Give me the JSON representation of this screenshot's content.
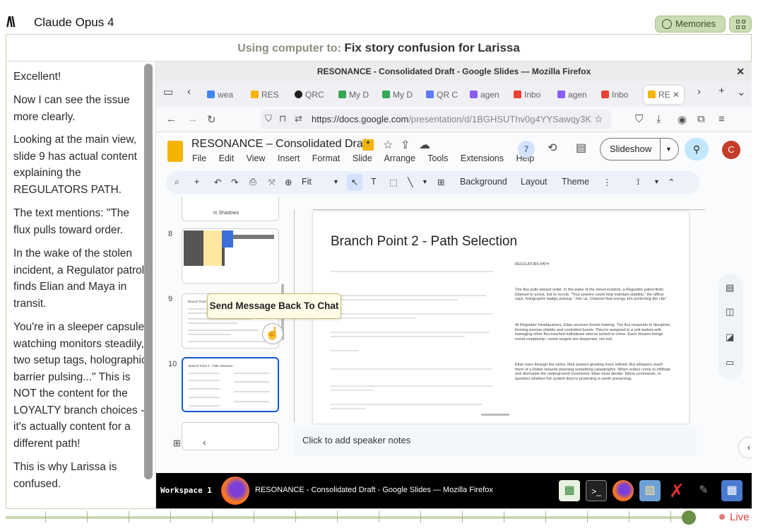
{
  "app": {
    "model_name": "Claude Opus 4",
    "memories_label": "Memories"
  },
  "task": {
    "prefix": "Using computer to:",
    "title": "Fix story confusion for Larissa"
  },
  "chat": {
    "messages": [
      "Excellent!",
      "Now I can see the issue more clearly.",
      "Looking at the main view, slide 9 has actual content explaining the REGULATORS PATH.",
      "The text mentions: \"The flux pulls toward order.",
      "In the wake of the stolen incident, a Regulator patrol finds Elian and Maya in transit.",
      "You're in a sleeper capsule watching monitors steadily, two setup tags, holographic barrier pulsing...\" This is NOT the content for the LOYALTY branch choices - it's actually content for a different path!",
      "This is why Larissa is confused."
    ]
  },
  "browser": {
    "window_title": "RESONANCE - Consolidated Draft - Google Slides — Mozilla Firefox",
    "tabs": [
      {
        "label": "wea",
        "icon": "google-icon"
      },
      {
        "label": "RES",
        "icon": "slides-icon"
      },
      {
        "label": "QRC",
        "icon": "github-icon"
      },
      {
        "label": "My D",
        "icon": "drive-icon"
      },
      {
        "label": "My D",
        "icon": "drive-icon"
      },
      {
        "label": "QR C",
        "icon": "qr-icon"
      },
      {
        "label": "agen",
        "icon": "chat-icon"
      },
      {
        "label": "Inbo",
        "icon": "gmail-icon"
      },
      {
        "label": "agen",
        "icon": "chat-icon"
      },
      {
        "label": "Inbo",
        "icon": "gmail-icon"
      },
      {
        "label": "RE",
        "icon": "slides-icon"
      }
    ],
    "url_host": "https://docs.google.com",
    "url_path": "/presentation/d/1BGHSUThv0g4YYSawqy3K"
  },
  "slides": {
    "doc_title": "RESONANCE – Consolidated Draft",
    "menu": [
      "File",
      "Edit",
      "View",
      "Insert",
      "Format",
      "Slide",
      "Arrange",
      "Tools",
      "Extensions",
      "Help"
    ],
    "collab_count": "7",
    "slideshow_label": "Slideshow",
    "avatar_initial": "C",
    "toolbar": {
      "zoom": "Fit",
      "background": "Background",
      "layout": "Layout",
      "theme": "Theme"
    },
    "filmstrip": [
      {
        "num": "",
        "caption": "in Shadows"
      },
      {
        "num": "8",
        "caption": ""
      },
      {
        "num": "9",
        "caption": "Branch Point 2 - LOYALTY"
      },
      {
        "num": "10",
        "caption": "Branch Point 2 - Path Selection"
      }
    ],
    "tooltip": "Send Message Back To Chat",
    "slide": {
      "title": "Branch Point 2 - Path Selection",
      "right_heading": "REGULATORS PATH",
      "paragraphs": [
        "The flux pulls toward order. In the wake of the street incident, a Regulator patrol finds Eliansol to arrest, but to recruit. \"Your powers could help maintain stability,\" the officer says, holographic badge pulsing. \"Join us. Channel that energy into protecting the city.\"",
        "At Regulator headquarters, Elian receives formal training. The flux responds to discipline, forming precise shields and controlled bursts. They're assigned to a unit tasked with managing other flux-touched individuals who've turned to crime. Each mission brings moral complexity—some targets are desperate, not evil.",
        "Elian rises through the ranks, their powers growing more refined. But whispers reach them of a Rebel network planning something catastrophic. When orders come to infiltrate and dismantle the underground movement, Elian must decide: follow commands, or question whether the system they're protecting is worth preserving."
      ]
    },
    "speaker_notes": "Click to add speaker notes"
  },
  "dock": {
    "workspace": "Workspace 1",
    "window_title": "RESONANCE - Consolidated Draft - Google Slides — Mozilla Firefox"
  },
  "status": {
    "live_label": "Live"
  },
  "colors": {
    "accent_green": "#6a8f47",
    "live_red": "#d9413d",
    "selection_blue": "#1a56d6"
  }
}
